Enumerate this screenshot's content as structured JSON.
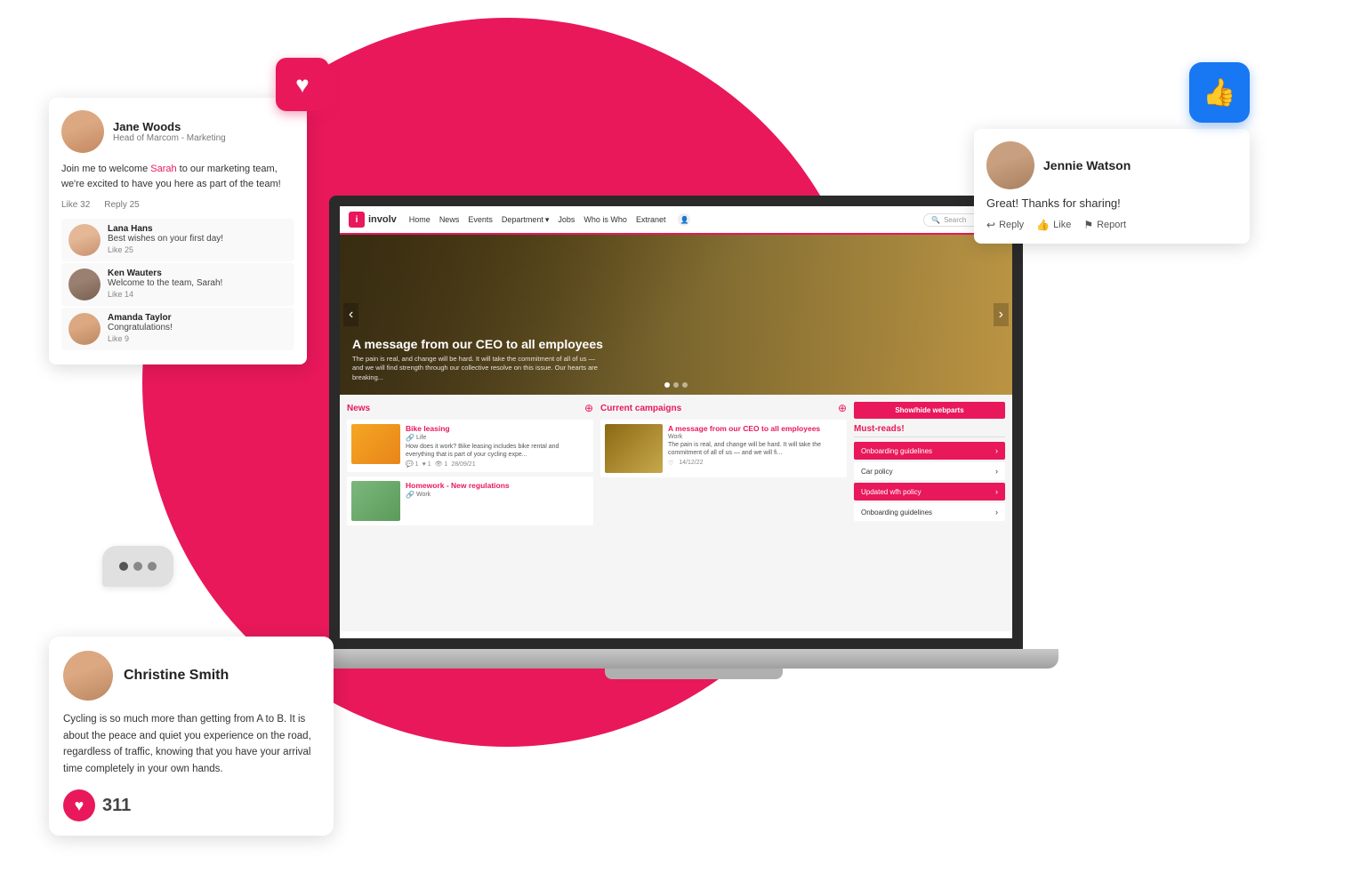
{
  "brand": {
    "logo_icon": "i",
    "logo_text": "involv"
  },
  "nav": {
    "items": [
      {
        "label": "Home",
        "active": false
      },
      {
        "label": "News",
        "active": false
      },
      {
        "label": "Events",
        "active": false
      },
      {
        "label": "Department",
        "active": false,
        "has_dropdown": true
      },
      {
        "label": "Jobs",
        "active": false
      },
      {
        "label": "Who is Who",
        "active": false
      },
      {
        "label": "Extranet",
        "active": false
      }
    ],
    "search_placeholder": "Search"
  },
  "hero": {
    "title": "A message from our CEO to all employees",
    "description": "The pain is real, and change will be hard. It will take the commitment of all of us — and we will find strength through our collective resolve on this issue.  Our hearts are breaking..."
  },
  "news": {
    "section_title": "News",
    "items": [
      {
        "title": "Bike leasing",
        "category": "Life",
        "excerpt": "How does it work? Bike leasing includes bike rental and everything that is part of your cycling expe...",
        "comments": "1",
        "likes": "1",
        "views": "1",
        "date": "28/09/21"
      },
      {
        "title": "Homework - New regulations",
        "category": "Work",
        "excerpt": ""
      }
    ]
  },
  "campaigns": {
    "section_title": "Current campaigns",
    "item": {
      "title": "A message from our CEO to all employees",
      "category": "Work",
      "excerpt": "The pain is real, and change will be hard. It will take the commitment of all of us — and we will fi...",
      "date": "14/12/22"
    }
  },
  "must_reads": {
    "show_hide_label": "Show/hide webparts",
    "title": "Must-reads!",
    "items": [
      {
        "label": "Onboarding guidelines",
        "highlight": true
      },
      {
        "label": "Car policy",
        "highlight": false
      },
      {
        "label": "Updated wfh policy",
        "highlight": true
      },
      {
        "label": "Onboarding guidelines",
        "highlight": false
      }
    ]
  },
  "card_jane": {
    "name": "Jane Woods",
    "role": "Head of Marcom - Marketing",
    "post_text_before": "Join me to welcome ",
    "mention": "Sarah",
    "post_text_after": " to our marketing team, we're excited to have you here as part of the team!",
    "like_count": "32",
    "reply_count": "25",
    "like_label": "Like",
    "reply_label": "Reply",
    "comments": [
      {
        "name": "Lana Hans",
        "text": "Best wishes on your first day!",
        "like_label": "Like",
        "like_count": "25"
      },
      {
        "name": "Ken Wauters",
        "text": "Welcome to the team, Sarah!",
        "like_label": "Like",
        "like_count": "14"
      },
      {
        "name": "Amanda Taylor",
        "text": "Congratulations!",
        "like_label": "Like",
        "like_count": "9"
      }
    ]
  },
  "card_jennie": {
    "name": "Jennie Watson",
    "text": "Great! Thanks for sharing!",
    "actions": {
      "reply": "Reply",
      "like": "Like",
      "report": "Report"
    }
  },
  "card_christine": {
    "name": "Christine Smith",
    "text": "Cycling is so much more than getting from A to B. It is about the peace and quiet you experience on the road, regardless of traffic, knowing that you have your arrival time completely in your own hands.",
    "heart_count": "311"
  },
  "typing_dots": [
    "•",
    "•",
    "•"
  ],
  "colors": {
    "brand_pink": "#e8185a",
    "facebook_blue": "#1877f2",
    "heart_red": "#e8185a"
  }
}
